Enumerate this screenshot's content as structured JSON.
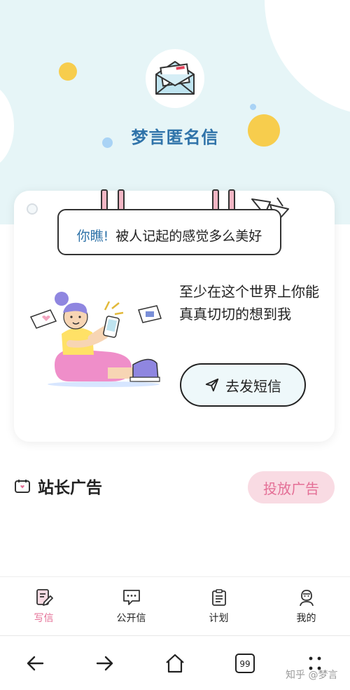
{
  "app": {
    "title": "梦言匿名信"
  },
  "card": {
    "sign_highlight": "你瞧!",
    "sign_text": "被人记起的感觉多么美好",
    "slogan": "至少在这个世界上你能真真切切的想到我",
    "send_button": "去发短信"
  },
  "ads": {
    "title": "站长广告",
    "button": "投放广告"
  },
  "tabs": [
    {
      "label": "写信",
      "icon": "write-letter-icon",
      "active": true
    },
    {
      "label": "公开信",
      "icon": "chat-bubble-icon",
      "active": false
    },
    {
      "label": "计划",
      "icon": "clipboard-icon",
      "active": false
    },
    {
      "label": "我的",
      "icon": "person-icon",
      "active": false
    }
  ],
  "browser_nav": {
    "tabs_count": "99",
    "icons": [
      "back-arrow-icon",
      "forward-arrow-icon",
      "home-icon",
      "tabs-icon",
      "more-dots-icon"
    ]
  },
  "watermark": "知乎 @梦言",
  "colors": {
    "brand_blue": "#2f73a9",
    "accent_pink": "#e46f96",
    "hero_bg": "#e6f5f7",
    "dot_yellow": "#f7cd4d"
  }
}
